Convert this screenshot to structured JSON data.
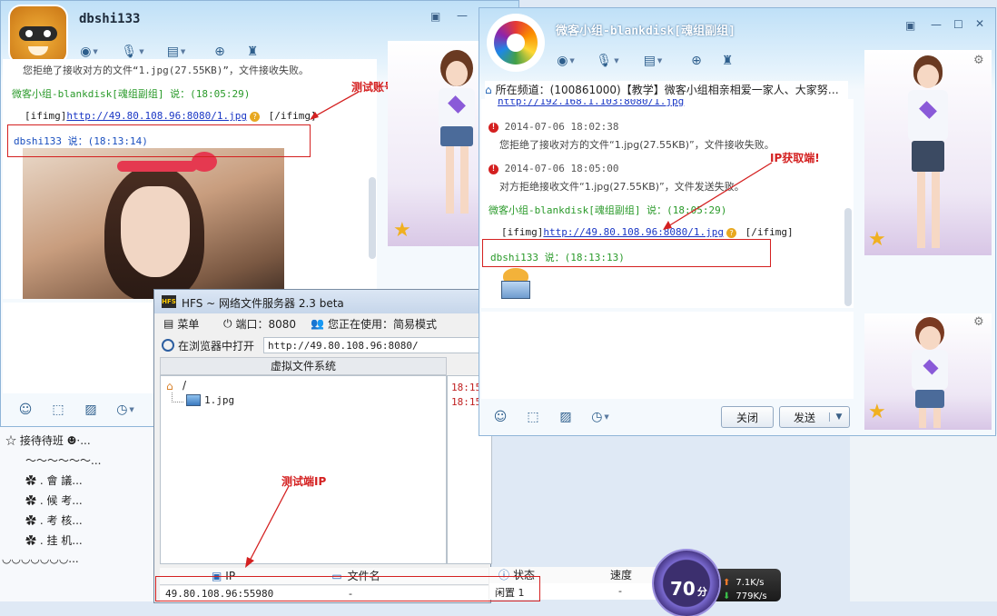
{
  "left_chat": {
    "title": "dbshi133",
    "messages": [
      {
        "sender": "微客小组-blankdisk[魂组副组] 说：(18:05:29)",
        "text_prefix": "[ifimg]",
        "link": "http://49.80.108.96:8080/1.jpg",
        "text_suffix": " [/ifimg]"
      },
      {
        "sender": "dbshi133 说：(18:13:14)"
      }
    ],
    "partial_top": "您拒绝了接收对方的文件“1.jpg(27.55KB)”，文件接收失败。",
    "annotation_account": "测试账号"
  },
  "right_chat": {
    "title": "微客小组-blankdisk[魂组副组]",
    "channel_label": "所在频道：",
    "channel_value": "(100861000)【教学】微客小组相亲相爱一家人、大家努…",
    "partial_top_link": "http://192.168.1.103:8080/1.jpg",
    "events": [
      {
        "time": "2014-07-06 18:02:38",
        "text": "您拒绝了接收对方的文件“1.jpg(27.55KB)”，文件接收失败。"
      },
      {
        "time": "2014-07-06 18:05:00",
        "text": "对方拒绝接收文件“1.jpg(27.55KB)”，文件发送失败。"
      }
    ],
    "msg_sender": "微客小组-blankdisk[魂组副组] 说：(18:05:29)",
    "msg_prefix": "[ifimg]",
    "msg_link": "http://49.80.108.96:8080/1.jpg",
    "msg_suffix": " [/ifimg]",
    "msg2_sender": "dbshi133 说：(18:13:13)",
    "annotation_ip": "IP获取端!",
    "close_label": "关闭",
    "send_label": "发送"
  },
  "hfs": {
    "title": "HFS ~ 网络文件服务器 2.3 beta",
    "logo_text": "HFS",
    "menu_label": "菜单",
    "port_label": "端口：8080",
    "mode_label": "您正在使用：简易模式",
    "open_browser_label": "在浏览器中打开",
    "url": "http://49.80.108.96:8080/",
    "vfs_header": "虚拟文件系统",
    "root": "/",
    "file": "1.jpg",
    "log_lines": [
      "18:15",
      "18:15"
    ],
    "columns": [
      "IP",
      "文件名",
      "状态",
      "速度"
    ],
    "row": {
      "ip": "49.80.108.96:55980",
      "file": "-",
      "status": "闲置 1",
      "speed": "-"
    },
    "annotation_test_ip": "测试端IP"
  },
  "left_list": {
    "items": [
      "☆ 接待待班  ☻·...",
      "～～～～～～...",
      "✿ . 會 議...",
      "✿ . 候 考...",
      "✿ . 考 核...",
      "✿ . 挂 机..."
    ],
    "bottom": "◡◡◡◡◡◡◡..."
  },
  "speed_widget": {
    "score": "70",
    "unit": "分",
    "up": "7.1K/s",
    "down": "779K/s"
  }
}
